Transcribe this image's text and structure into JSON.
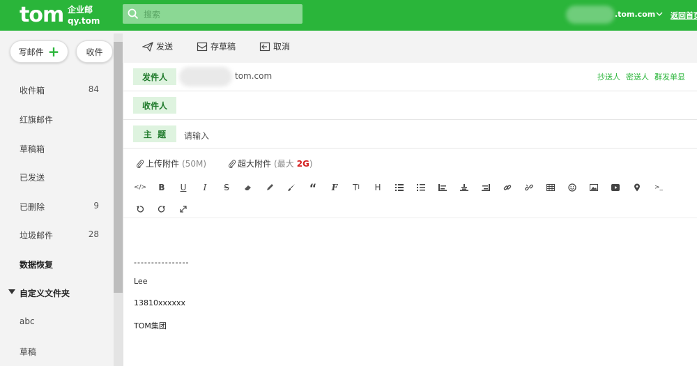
{
  "header": {
    "logo": "tom",
    "logo_sub1": "企业邮",
    "logo_sub2": "qy.tom",
    "search_placeholder": "搜索",
    "account": ".tom.com",
    "top_right": "返回首页"
  },
  "sidebar": {
    "compose_label": "写邮件",
    "receive_label": "收件",
    "folders": [
      {
        "label": "收件箱",
        "count": "84"
      },
      {
        "label": "红旗邮件",
        "count": ""
      },
      {
        "label": "草稿箱",
        "count": ""
      },
      {
        "label": "已发送",
        "count": ""
      },
      {
        "label": "已删除",
        "count": "9"
      },
      {
        "label": "垃圾邮件",
        "count": "28"
      },
      {
        "label": "数据恢复",
        "count": ""
      }
    ],
    "custom_folders_label": "自定义文件夹",
    "custom_folders": [
      "abc",
      "草稿"
    ]
  },
  "toolbar": {
    "send": "发送",
    "save_draft": "存草稿",
    "cancel": "取消"
  },
  "compose": {
    "from_label": "发件人",
    "from_domain": "tom.com",
    "to_label": "收件人",
    "subject_label": "主  题",
    "subject_placeholder": "请输入",
    "cc": "抄送人",
    "bcc": "密送人",
    "separate": "群发单显",
    "upload_attachment": "上传附件",
    "upload_limit": "(50M)",
    "large_attachment": "超大附件",
    "large_limit_prefix": "(最大",
    "large_limit_value": "2G",
    "large_limit_suffix": ")"
  },
  "signature": {
    "divider": "----------------",
    "name": "Lee",
    "phone": "13810xxxxxx",
    "company": "TOM集团"
  },
  "colors": {
    "brand": "#2ab53a",
    "tag_bg": "#def3df",
    "accent_red": "#d42020"
  }
}
